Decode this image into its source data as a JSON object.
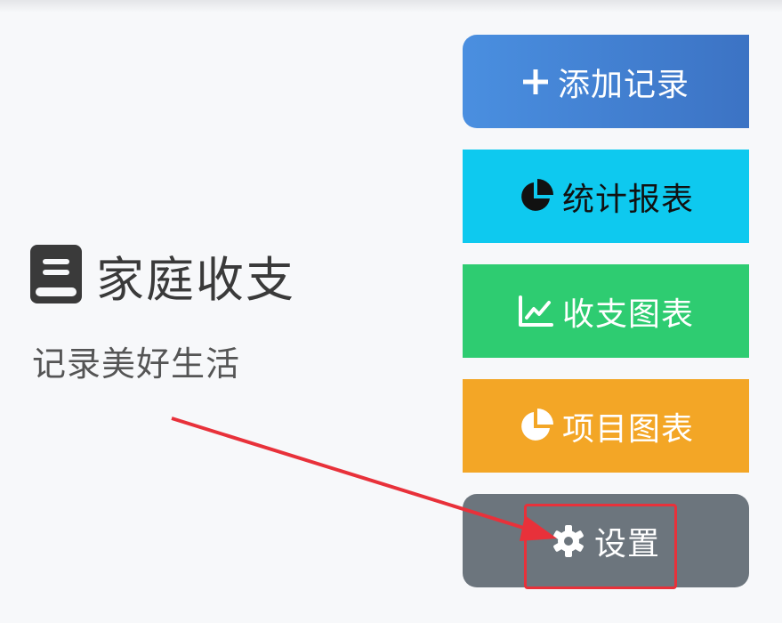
{
  "brand": {
    "title": "家庭收支",
    "tagline": "记录美好生活",
    "icon": "book-icon"
  },
  "menu": {
    "add": {
      "label": "添加记录",
      "icon": "plus-icon"
    },
    "stats": {
      "label": "统计报表",
      "icon": "pie-chart-icon"
    },
    "chart": {
      "label": "收支图表",
      "icon": "line-chart-icon"
    },
    "items": {
      "label": "项目图表",
      "icon": "pie-chart-icon"
    },
    "settings": {
      "label": "设置",
      "icon": "gear-icon"
    }
  },
  "colors": {
    "add": "#4a8fe0",
    "stats": "#0ec9ef",
    "chart": "#2ecc71",
    "items": "#f3a626",
    "settings": "#6c757d",
    "annotation": "#e8313a"
  }
}
